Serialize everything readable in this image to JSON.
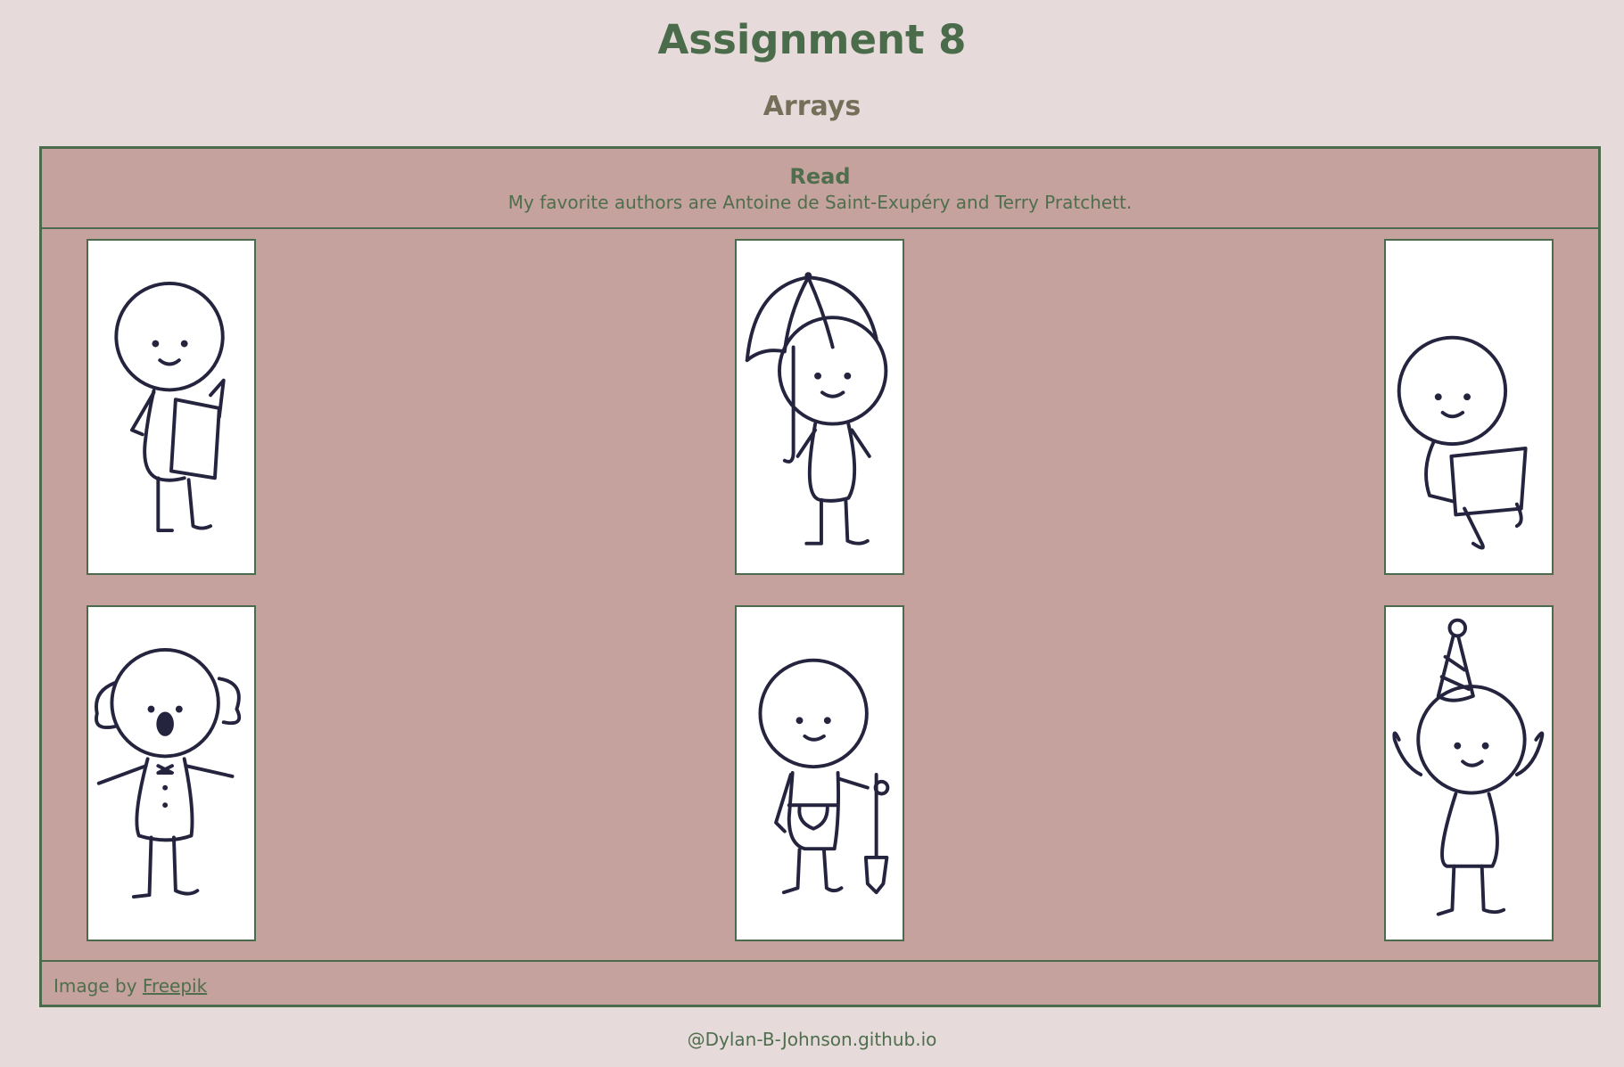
{
  "header": {
    "title": "Assignment 8",
    "subtitle": "Arrays"
  },
  "card": {
    "title": "Read",
    "text": "My favorite authors are Antoine de Saint-Exupéry and Terry Pratchett.",
    "images": [
      {
        "name": "reading-figure-image",
        "icon": "stick-figure-reading-book"
      },
      {
        "name": "umbrella-figure-image",
        "icon": "stick-figure-with-umbrella"
      },
      {
        "name": "laptop-figure-image",
        "icon": "stick-figure-with-laptop"
      },
      {
        "name": "clown-figure-image",
        "icon": "stick-figure-clown"
      },
      {
        "name": "gardener-figure-image",
        "icon": "stick-figure-with-shovel"
      },
      {
        "name": "party-figure-image",
        "icon": "stick-figure-party-hat"
      }
    ],
    "footer": {
      "prefix": "Image by ",
      "link_label": "Freepik"
    }
  },
  "site_footer": "@Dylan-B-Johnson.github.io",
  "colors": {
    "background": "#e7dada",
    "card": "#c5a29d",
    "accent_green": "#4a6c4a",
    "subtitle": "#756e58",
    "figure_ink": "#25243f"
  }
}
